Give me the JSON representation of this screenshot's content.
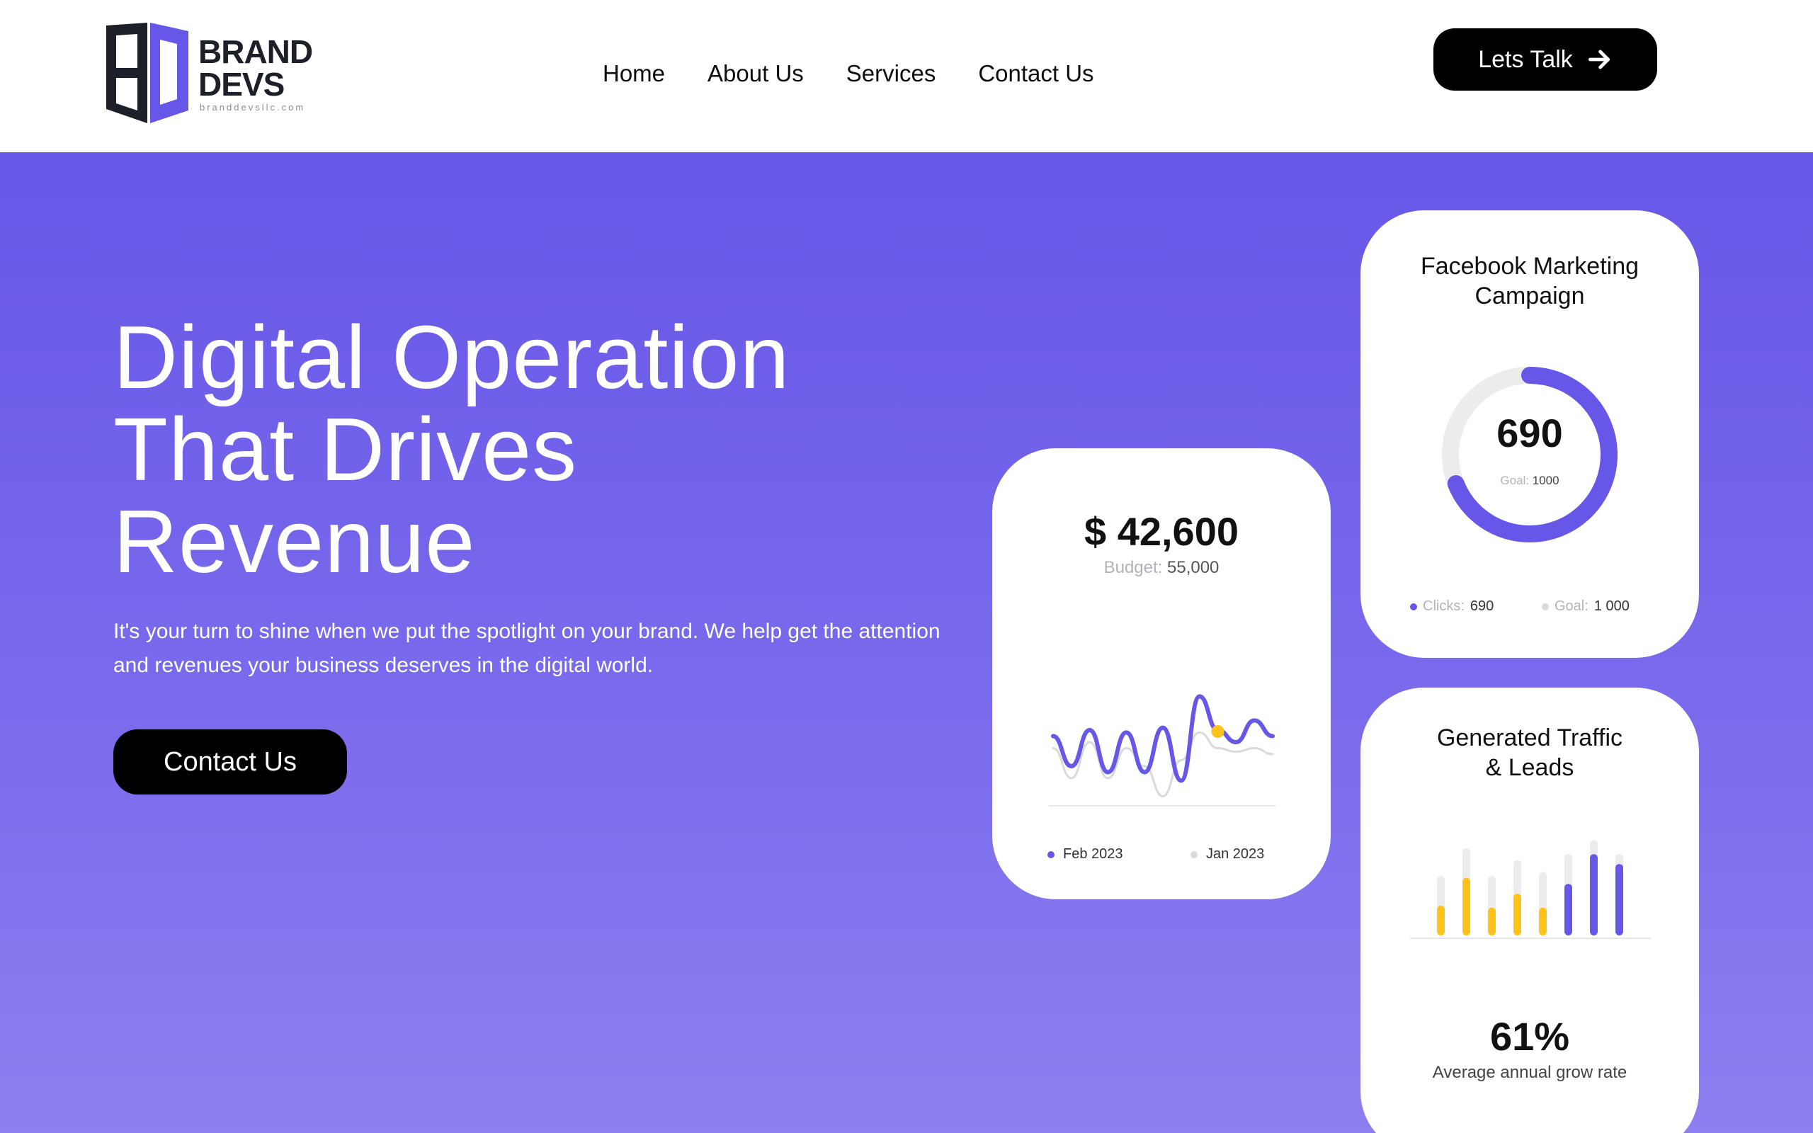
{
  "brand": {
    "name_line1": "BRAND",
    "name_line2": "DEVS",
    "url": "branddevsllc.com",
    "mark_colors": {
      "dark": "#1d2029",
      "accent": "#6657e8"
    }
  },
  "nav": {
    "items": [
      {
        "label": "Home"
      },
      {
        "label": "About Us"
      },
      {
        "label": "Services"
      },
      {
        "label": "Contact Us"
      }
    ],
    "cta_label": "Lets Talk",
    "cta_icon": "arrow-right-icon"
  },
  "hero": {
    "title_line1": "Digital Operation",
    "title_line2": "That Drives",
    "title_line3": "Revenue",
    "subtitle": "It's your turn to shine when we put the spotlight on your brand. We help get the attention and revenues your business deserves in the digital world.",
    "cta_label": "Contact Us"
  },
  "colors": {
    "primary": "#6657e8",
    "accent_yellow": "#ffc21a",
    "muted_gray": "#e6e6ea"
  },
  "budget_card": {
    "amount": "$ 42,600",
    "budget_label": "Budget:",
    "budget_value": "55,000",
    "legend": [
      {
        "label": "Feb 2023",
        "color": "#6657e8"
      },
      {
        "label": "Jan 2023",
        "color": "#d9d9de"
      }
    ],
    "chart_data": {
      "type": "line",
      "series": [
        {
          "name": "Feb 2023",
          "color": "#6657e8",
          "values": [
            55,
            30,
            60,
            25,
            58,
            25,
            62,
            18,
            88,
            60,
            50,
            68,
            55
          ]
        },
        {
          "name": "Jan 2023",
          "color": "#d9d9de",
          "values": [
            45,
            20,
            50,
            20,
            45,
            30,
            5,
            35,
            58,
            45,
            42,
            45,
            40
          ]
        }
      ],
      "highlight_index": 9,
      "highlight_color": "#ffc21a",
      "ylim": [
        0,
        100
      ]
    }
  },
  "fb_card": {
    "title_line1": "Facebook Marketing",
    "title_line2": "Campaign",
    "value": "690",
    "goal_label": "Goal:",
    "goal_value": "1000",
    "legend": [
      {
        "label": "Clicks:",
        "value": "690",
        "color": "#6657e8"
      },
      {
        "label": "Goal:",
        "value": "1 000",
        "color": "#d9d9de"
      }
    ],
    "chart_data": {
      "type": "pie",
      "categories": [
        "Clicks",
        "Remaining"
      ],
      "values": [
        690,
        310
      ]
    }
  },
  "traffic_card": {
    "title_line1": "Generated Traffic",
    "title_line2": "& Leads",
    "value": "61%",
    "caption": "Average annual grow rate",
    "chart_data": {
      "type": "bar",
      "categories": [
        "1",
        "2",
        "3",
        "4",
        "5",
        "6",
        "7",
        "8"
      ],
      "series": [
        {
          "name": "background",
          "values": [
            60,
            88,
            60,
            76,
            64,
            82,
            96,
            82
          ]
        },
        {
          "name": "value",
          "values": [
            30,
            58,
            28,
            42,
            28,
            52,
            82,
            72
          ]
        }
      ],
      "bar_colors": [
        "#ffc21a",
        "#ffc21a",
        "#ffc21a",
        "#ffc21a",
        "#ffc21a",
        "#6657e8",
        "#6657e8",
        "#6657e8"
      ],
      "ylim": [
        0,
        100
      ]
    }
  }
}
